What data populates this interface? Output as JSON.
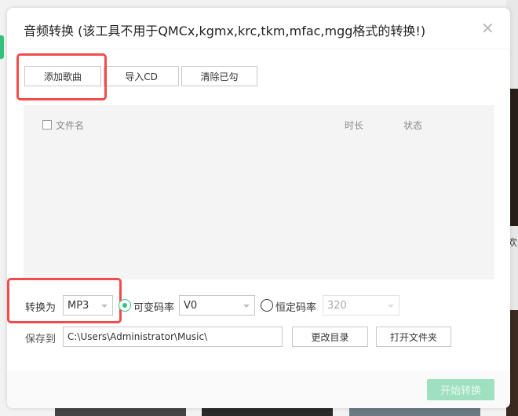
{
  "dialog": {
    "title": "音频转换 (该工具不用于QMCx,kgmx,krc,tkm,mfac,mgg格式的转换!)",
    "close": "✕"
  },
  "toolbar": {
    "add_song": "添加歌曲",
    "import_cd": "导入CD",
    "clear_checked": "清除已勾"
  },
  "list": {
    "col_filename": "文件名",
    "col_duration": "时长",
    "col_status": "状态"
  },
  "convert": {
    "label": "转换为",
    "format": "MP3",
    "vbr_label": "可变码率",
    "vbr_value": "V0",
    "cbr_label": "恒定码率",
    "cbr_value": "320",
    "vbr_selected": true
  },
  "save": {
    "label": "保存到",
    "path": "C:\\Users\\Administrator\\Music\\",
    "change_dir": "更改目录",
    "open_folder": "打开文件夹"
  },
  "footer": {
    "start": "开始转换"
  },
  "background": {
    "partial_text": "欢"
  },
  "colors": {
    "accent": "#31c27c",
    "highlight": "#f04c4c"
  }
}
